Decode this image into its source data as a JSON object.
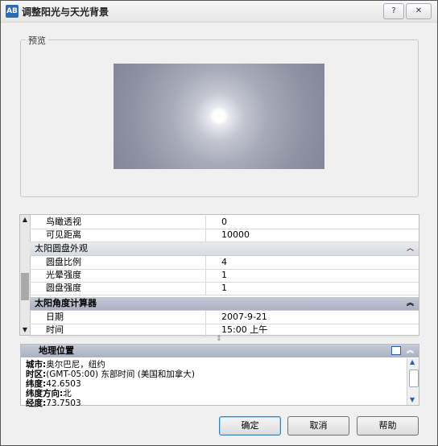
{
  "window": {
    "title": "调整阳光与天光背景",
    "help_btn": "?",
    "close_btn": "✕",
    "icon_text": "AB"
  },
  "preview": {
    "label": "预览"
  },
  "properties": {
    "rows": [
      {
        "name": "鸟瞰透视",
        "value": "0"
      },
      {
        "name": "可见距离",
        "value": "10000"
      }
    ],
    "category_disk": "太阳圆盘外观",
    "disk_rows": [
      {
        "name": "圆盘比例",
        "value": "4"
      },
      {
        "name": "光晕强度",
        "value": "1"
      },
      {
        "name": "圆盘强度",
        "value": "1"
      }
    ],
    "category_calc": "太阳角度计算器",
    "calc_rows": [
      {
        "name": "日期",
        "value": "2007-9-21"
      },
      {
        "name": "时间",
        "value": "15:00 上午"
      }
    ],
    "collapse_icon": "︽",
    "expand_icon": "︿"
  },
  "geo": {
    "title": "地理位置",
    "lines": [
      {
        "key": "城市:",
        "value": "奥尔巴尼，纽约"
      },
      {
        "key": "时区:",
        "value": "(GMT-05:00) 东部时间 (美国和加拿大)"
      },
      {
        "key": "纬度:",
        "value": "42.6503"
      },
      {
        "key": "纬度方向:",
        "value": "北"
      },
      {
        "key": "经度:",
        "value": "73.7503"
      }
    ]
  },
  "buttons": {
    "ok": "确定",
    "cancel": "取消",
    "help": "帮助"
  }
}
